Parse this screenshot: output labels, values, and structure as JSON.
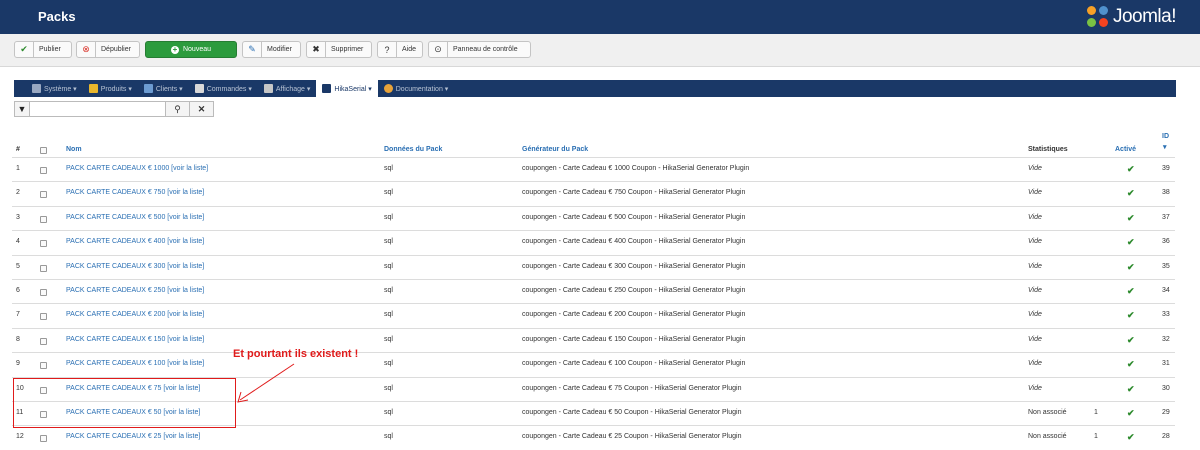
{
  "header": {
    "title": "Packs",
    "logo_text": "Joomla!"
  },
  "toolbar": {
    "publish": "Publier",
    "unpublish": "Dépublier",
    "new": "Nouveau",
    "edit": "Modifier",
    "delete": "Supprimer",
    "help": "Aide",
    "control_panel": "Panneau de contrôle"
  },
  "menu": {
    "items": [
      {
        "label": "Système ▾"
      },
      {
        "label": "Produits ▾"
      },
      {
        "label": "Clients ▾"
      },
      {
        "label": "Commandes ▾"
      },
      {
        "label": "Affichage ▾"
      },
      {
        "label": "HikaSerial ▾"
      },
      {
        "label": "Documentation ▾"
      }
    ]
  },
  "table": {
    "columns": {
      "num": "#",
      "name": "Nom",
      "data": "Données du Pack",
      "generator": "Générateur du Pack",
      "stats": "Statistiques",
      "active": "Activé",
      "id": "ID",
      "id_sort": "▾"
    },
    "rows": [
      {
        "num": "1",
        "name": "PACK CARTE CADEAUX € 1000 [voir la liste]",
        "data": "sql",
        "generator": "coupongen - Carte Cadeau € 1000 Coupon - HikaSerial Generator Plugin",
        "stats": "Vide",
        "stat_count": "",
        "id": "39"
      },
      {
        "num": "2",
        "name": "PACK CARTE CADEAUX € 750 [voir la liste]",
        "data": "sql",
        "generator": "coupongen - Carte Cadeau € 750 Coupon - HikaSerial Generator Plugin",
        "stats": "Vide",
        "stat_count": "",
        "id": "38"
      },
      {
        "num": "3",
        "name": "PACK CARTE CADEAUX € 500 [voir la liste]",
        "data": "sql",
        "generator": "coupongen - Carte Cadeau € 500 Coupon - HikaSerial Generator Plugin",
        "stats": "Vide",
        "stat_count": "",
        "id": "37"
      },
      {
        "num": "4",
        "name": "PACK CARTE CADEAUX € 400 [voir la liste]",
        "data": "sql",
        "generator": "coupongen - Carte Cadeau € 400 Coupon - HikaSerial Generator Plugin",
        "stats": "Vide",
        "stat_count": "",
        "id": "36"
      },
      {
        "num": "5",
        "name": "PACK CARTE CADEAUX € 300 [voir la liste]",
        "data": "sql",
        "generator": "coupongen - Carte Cadeau € 300 Coupon - HikaSerial Generator Plugin",
        "stats": "Vide",
        "stat_count": "",
        "id": "35"
      },
      {
        "num": "6",
        "name": "PACK CARTE CADEAUX € 250 [voir la liste]",
        "data": "sql",
        "generator": "coupongen - Carte Cadeau € 250 Coupon - HikaSerial Generator Plugin",
        "stats": "Vide",
        "stat_count": "",
        "id": "34"
      },
      {
        "num": "7",
        "name": "PACK CARTE CADEAUX € 200 [voir la liste]",
        "data": "sql",
        "generator": "coupongen - Carte Cadeau € 200 Coupon - HikaSerial Generator Plugin",
        "stats": "Vide",
        "stat_count": "",
        "id": "33"
      },
      {
        "num": "8",
        "name": "PACK CARTE CADEAUX € 150 [voir la liste]",
        "data": "sql",
        "generator": "coupongen - Carte Cadeau € 150 Coupon - HikaSerial Generator Plugin",
        "stats": "Vide",
        "stat_count": "",
        "id": "32"
      },
      {
        "num": "9",
        "name": "PACK CARTE CADEAUX € 100 [voir la liste]",
        "data": "sql",
        "generator": "coupongen - Carte Cadeau € 100 Coupon - HikaSerial Generator Plugin",
        "stats": "Vide",
        "stat_count": "",
        "id": "31"
      },
      {
        "num": "10",
        "name": "PACK CARTE CADEAUX € 75 [voir la liste]",
        "data": "sql",
        "generator": "coupongen - Carte Cadeau € 75 Coupon - HikaSerial Generator Plugin",
        "stats": "Vide",
        "stat_count": "",
        "id": "30"
      },
      {
        "num": "11",
        "name": "PACK CARTE CADEAUX € 50 [voir la liste]",
        "data": "sql",
        "generator": "coupongen - Carte Cadeau € 50 Coupon - HikaSerial Generator Plugin",
        "stats": "Non associé",
        "stat_count": "1",
        "id": "29"
      },
      {
        "num": "12",
        "name": "PACK CARTE CADEAUX € 25 [voir la liste]",
        "data": "sql",
        "generator": "coupongen - Carte Cadeau € 25 Coupon - HikaSerial Generator Plugin",
        "stats": "Non associé",
        "stat_count": "1",
        "id": "28"
      }
    ]
  },
  "annotation": {
    "text": "Et pourtant ils existent !"
  },
  "colors": {
    "header_bg": "#1a3867",
    "link": "#2a6fb3",
    "new_button": "#2c9b3d",
    "check": "#2d8a2d",
    "annotation": "#e01b1b"
  }
}
